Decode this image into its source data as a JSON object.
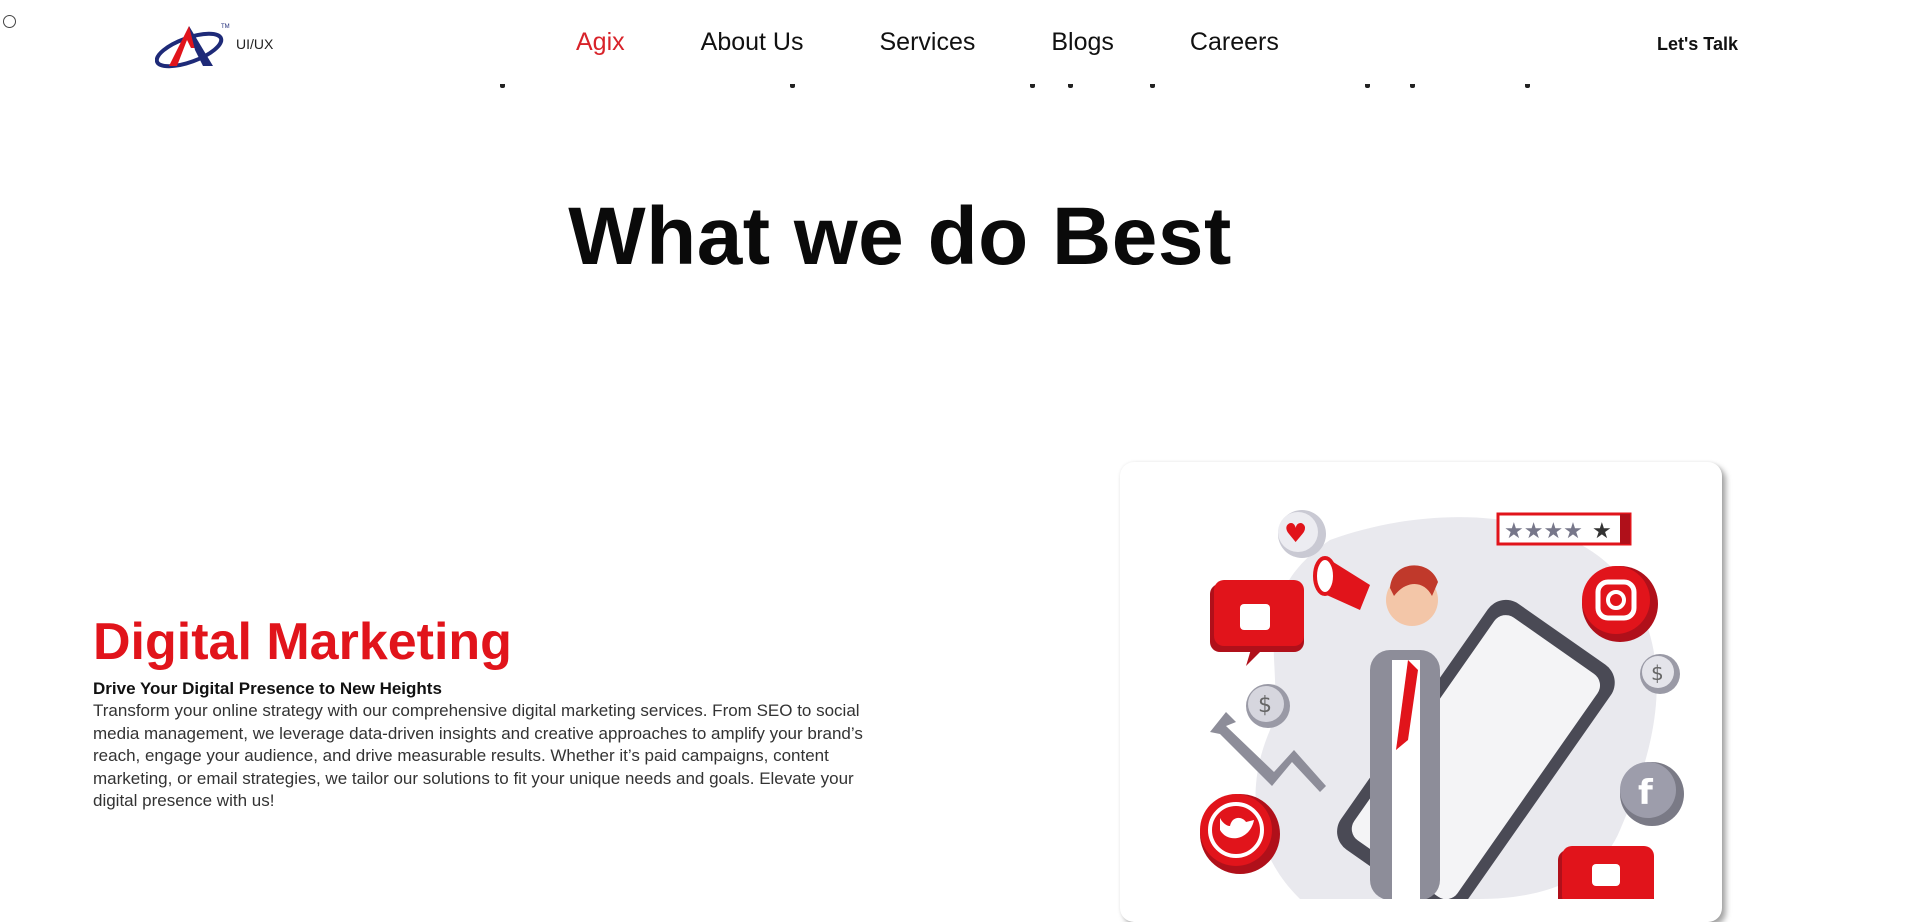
{
  "header": {
    "logo_text": "UI/UX",
    "nav": [
      "Agix",
      "About Us",
      "Services",
      "Blogs",
      "Careers"
    ],
    "cta": "Let's Talk"
  },
  "section": {
    "title": "What we do Best"
  },
  "service": {
    "title": "Digital Marketing",
    "subtitle": "Drive Your Digital Presence to New Heights",
    "description": "Transform your online strategy with our comprehensive digital marketing services. From SEO to social media management, we leverage data-driven insights and creative approaches to amplify your brand’s reach, engage your audience, and drive measurable results. Whether it’s paid campaigns, content marketing, or email strategies, we tailor our solutions to fit your unique needs and goals. Elevate your digital presence with us!",
    "rating_stars": 5
  },
  "colors": {
    "accent": "#e1141b",
    "nav_active": "#d8232a",
    "logo_blue": "#1e2a78"
  }
}
